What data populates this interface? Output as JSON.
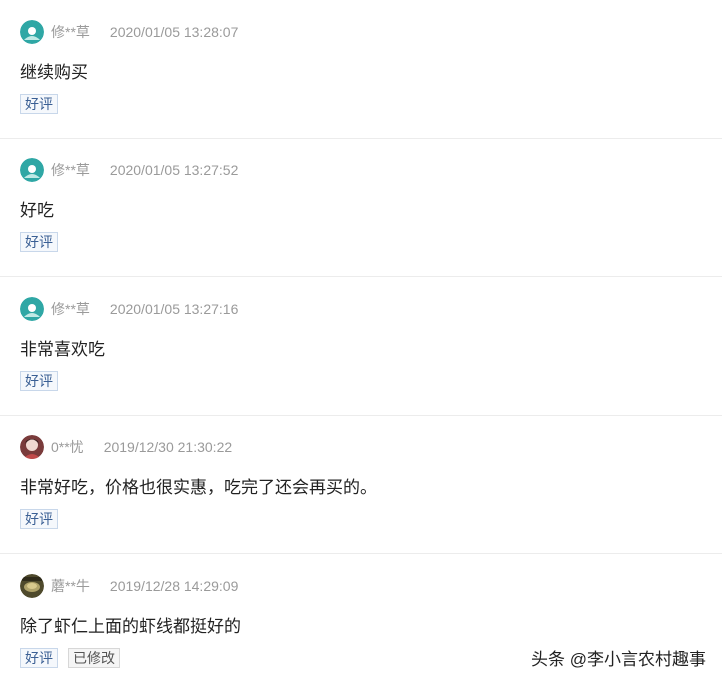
{
  "reviews": [
    {
      "username": "修**草",
      "time": "2020/01/05 13:28:07",
      "content": "继续购买",
      "tags": [
        "好评"
      ],
      "avatar": "teal-icon"
    },
    {
      "username": "修**草",
      "time": "2020/01/05 13:27:52",
      "content": "好吃",
      "tags": [
        "好评"
      ],
      "avatar": "teal-icon"
    },
    {
      "username": "修**草",
      "time": "2020/01/05 13:27:16",
      "content": "非常喜欢吃",
      "tags": [
        "好评"
      ],
      "avatar": "teal-icon"
    },
    {
      "username": "0**忧",
      "time": "2019/12/30 21:30:22",
      "content": "非常好吃，价格也很实惠，吃完了还会再买的。",
      "tags": [
        "好评"
      ],
      "avatar": "photo"
    },
    {
      "username": "蘑**牛",
      "time": "2019/12/28 14:29:09",
      "content": "除了虾仁上面的虾线都挺好的",
      "tags": [
        "好评",
        "已修改"
      ],
      "avatar": "photo"
    }
  ],
  "watermark": "头条 @李小言农村趣事",
  "colors": {
    "tag_border": "#c8d7ea",
    "tag_text": "#3a5f94",
    "meta_text": "#9a9a9a",
    "avatar_teal": "#2fa7a5"
  }
}
